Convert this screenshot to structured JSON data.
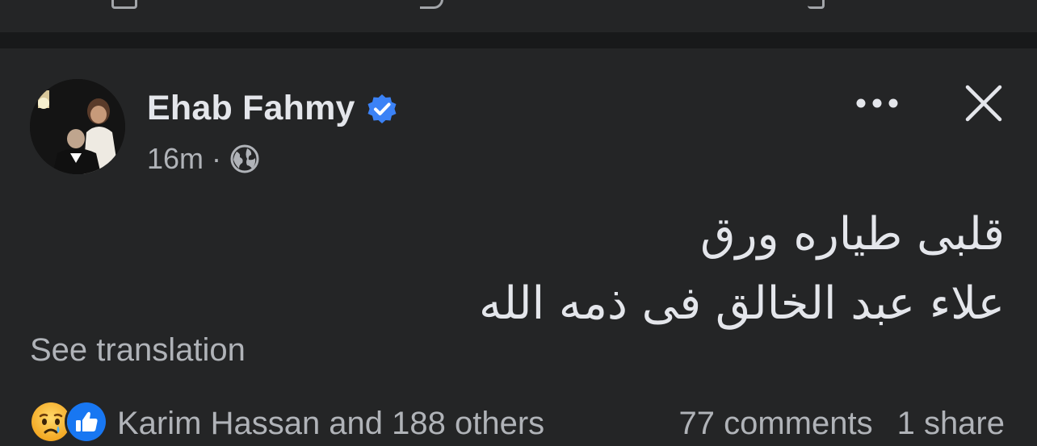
{
  "post": {
    "author": "Ehab Fahmy",
    "timestamp": "16m",
    "separator": "·",
    "audience_icon": "globe-icon",
    "verified_color": "#3b82f6",
    "message_lines": [
      "قلبى طياره ورق",
      "علاء عبد الخالق فى ذمه الله"
    ],
    "see_translation": "See translation",
    "reactions": {
      "icons": [
        "sad-reaction-icon",
        "like-reaction-icon"
      ],
      "names": "Karim Hassan and 188 others"
    },
    "comments": "77 comments",
    "shares": "1 share"
  },
  "colors": {
    "background": "#242526",
    "divider": "#18191a",
    "text_primary": "#e4e6eb",
    "text_secondary": "#b0b3b8",
    "like_blue": "#1877f2"
  }
}
